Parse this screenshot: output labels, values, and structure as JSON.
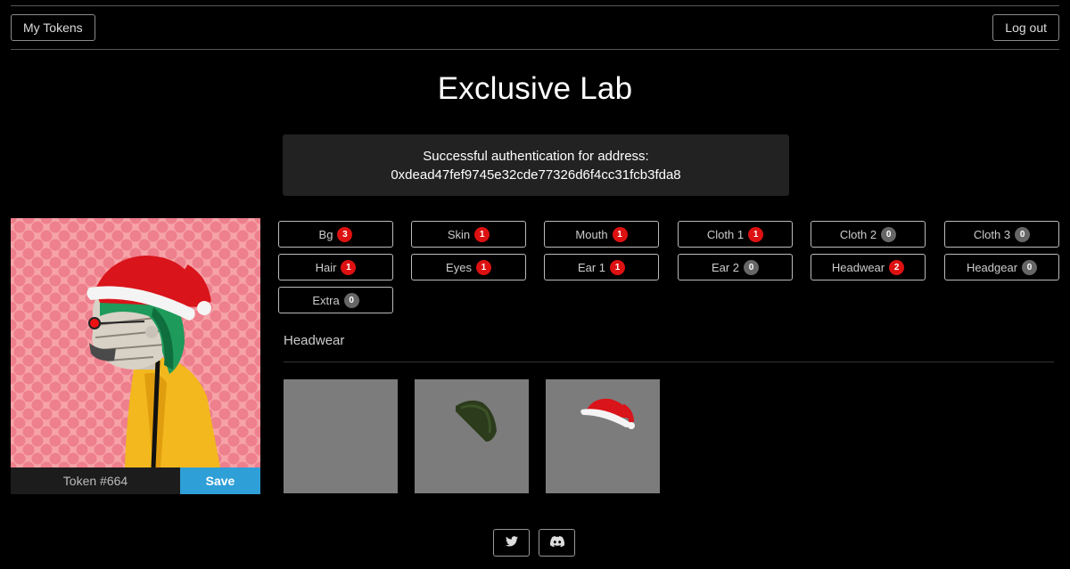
{
  "nav": {
    "my_tokens": "My Tokens",
    "logout": "Log out"
  },
  "title": "Exclusive Lab",
  "auth": {
    "line1": "Successful authentication for address:",
    "address": "0xdead47fef9745e32cde77326d6f4cc31fcb3fda8"
  },
  "token": {
    "label": "Token #664",
    "save": "Save"
  },
  "traits": [
    {
      "name": "Bg",
      "count": "3",
      "color": "red"
    },
    {
      "name": "Skin",
      "count": "1",
      "color": "red"
    },
    {
      "name": "Mouth",
      "count": "1",
      "color": "red"
    },
    {
      "name": "Cloth 1",
      "count": "1",
      "color": "red"
    },
    {
      "name": "Cloth 2",
      "count": "0",
      "color": "gray"
    },
    {
      "name": "Cloth 3",
      "count": "0",
      "color": "gray"
    },
    {
      "name": "Hair",
      "count": "1",
      "color": "red"
    },
    {
      "name": "Eyes",
      "count": "1",
      "color": "red"
    },
    {
      "name": "Ear 1",
      "count": "1",
      "color": "red"
    },
    {
      "name": "Ear 2",
      "count": "0",
      "color": "gray"
    },
    {
      "name": "Headwear",
      "count": "2",
      "color": "red"
    },
    {
      "name": "Headgear",
      "count": "0",
      "color": "gray"
    },
    {
      "name": "Extra",
      "count": "0",
      "color": "gray"
    }
  ],
  "section": {
    "title": "Headwear"
  },
  "options": [
    {
      "name": "empty"
    },
    {
      "name": "green-beanie"
    },
    {
      "name": "santa-hat"
    }
  ],
  "footer": {
    "icons": [
      "twitter-icon",
      "discord-icon"
    ]
  },
  "colors": {
    "accent": "#2f9fd8",
    "badge_red": "#dd1111",
    "badge_gray": "#666666",
    "panel": "#222222"
  }
}
